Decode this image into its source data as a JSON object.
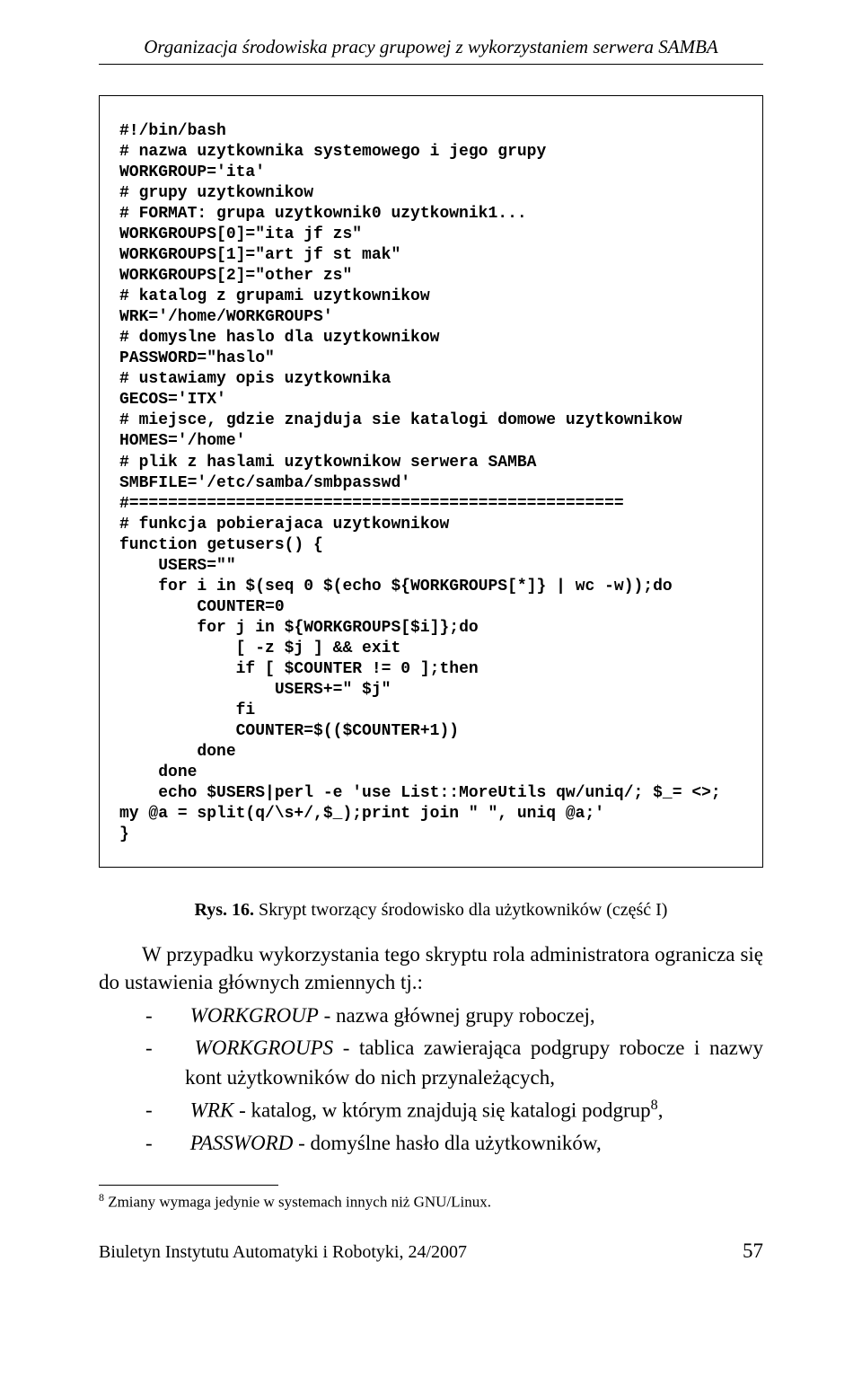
{
  "header": {
    "running_title": "Organizacja środowiska pracy grupowej z wykorzystaniem serwera SAMBA"
  },
  "code": {
    "content": "#!/bin/bash\n# nazwa uzytkownika systemowego i jego grupy\nWORKGROUP='ita'\n# grupy uzytkownikow\n# FORMAT: grupa uzytkownik0 uzytkownik1...\nWORKGROUPS[0]=\"ita jf zs\"\nWORKGROUPS[1]=\"art jf st mak\"\nWORKGROUPS[2]=\"other zs\"\n# katalog z grupami uzytkownikow\nWRK='/home/WORKGROUPS'\n# domyslne haslo dla uzytkownikow\nPASSWORD=\"haslo\"\n# ustawiamy opis uzytkownika\nGECOS='ITX'\n# miejsce, gdzie znajduja sie katalogi domowe uzytkownikow\nHOMES='/home'\n# plik z haslami uzytkownikow serwera SAMBA\nSMBFILE='/etc/samba/smbpasswd'\n#===================================================\n# funkcja pobierajaca uzytkownikow\nfunction getusers() {\n    USERS=\"\"\n    for i in $(seq 0 $(echo ${WORKGROUPS[*]} | wc -w));do\n        COUNTER=0\n        for j in ${WORKGROUPS[$i]};do\n            [ -z $j ] && exit\n            if [ $COUNTER != 0 ];then\n                USERS+=\" $j\"\n            fi\n            COUNTER=$(($COUNTER+1))\n        done\n    done\n    echo $USERS|perl -e 'use List::MoreUtils qw/uniq/; $_= <>; my @a = split(q/\\s+/,$_);print join \" \", uniq @a;'\n}"
  },
  "figure": {
    "label": "Rys. 16.",
    "caption": "Skrypt tworzący środowisko dla użytkowników (część I)"
  },
  "body": {
    "intro_part1": "W przypadku wykorzystania tego skryptu rola administratora ogranicza się do ustawienia głównych zmiennych tj.:",
    "items": [
      {
        "term": "WORKGROUP",
        "rest": " - nazwa głównej grupy roboczej,"
      },
      {
        "term": "WORKGROUPS",
        "rest": " - tablica zawierająca podgrupy robocze i nazwy kont użytkowników do nich przynależących,"
      },
      {
        "term": "WRK",
        "rest_before_sup": " - katalog, w którym znajdują się katalogi podgrup",
        "sup": "8",
        "rest_after_sup": ","
      },
      {
        "term": "PASSWORD",
        "rest": " - domyślne hasło dla użytkowników,"
      }
    ]
  },
  "footnote": {
    "marker": "8",
    "text": " Zmiany wymaga jedynie w systemach innych niż GNU/Linux."
  },
  "footer": {
    "journal": "Biuletyn Instytutu Automatyki i Robotyki, 24/2007",
    "page": "57"
  }
}
